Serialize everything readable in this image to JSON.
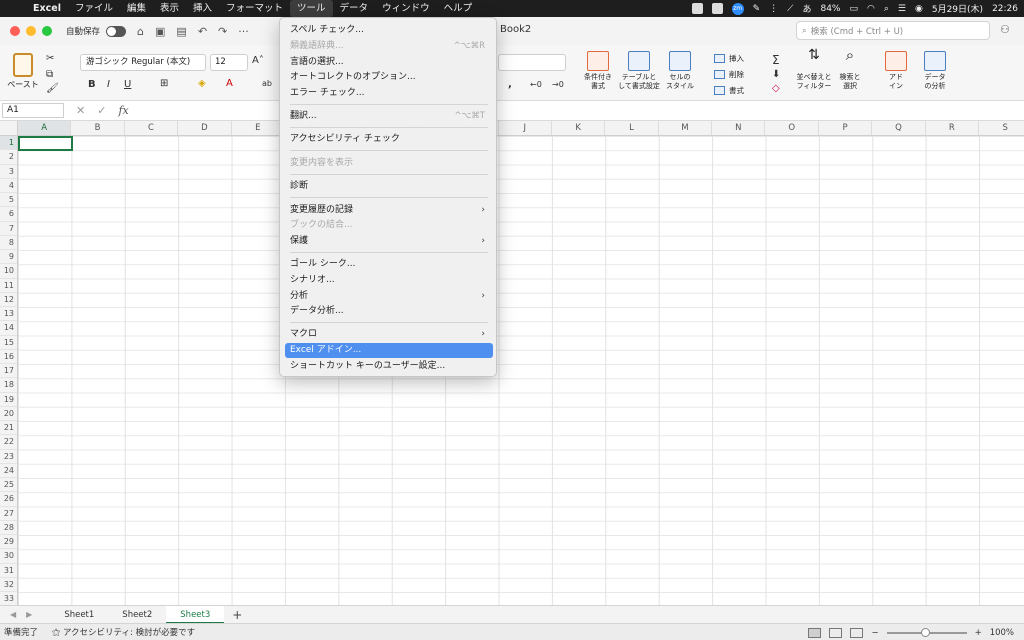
{
  "menubar": {
    "app": "Excel",
    "items": [
      "ファイル",
      "編集",
      "表示",
      "挿入",
      "フォーマット",
      "ツール",
      "データ",
      "ウィンドウ",
      "ヘルプ"
    ],
    "active": "ツール",
    "battery": "84%",
    "date": "5月29日(木)",
    "time": "22:26",
    "ime": "あ"
  },
  "titlebar": {
    "autosave": "自動保存",
    "doc_title": "Book2",
    "search_placeholder": "検索 (Cmd + Ctrl + U)"
  },
  "ribbon": {
    "paste": "ペースト",
    "font": "游ゴシック Regular (本文)",
    "size": "12",
    "bold": "B",
    "italic": "I",
    "underline": "U",
    "cond_format": "条件付き\n書式",
    "table_format": "テーブルと\nして書式設定",
    "cell_style": "セルの\nスタイル",
    "insert": "挿入",
    "delete": "削除",
    "format": "書式",
    "sort_filter": "並べ替えと\nフィルター",
    "find_select": "検索と\n選択",
    "addins": "アド\nイン",
    "data_analysis": "データ\nの分析"
  },
  "formulabar": {
    "namebox": "A1",
    "fx": "fx"
  },
  "grid": {
    "columns": [
      "A",
      "B",
      "C",
      "D",
      "E",
      "F",
      "G",
      "H",
      "I",
      "J",
      "K",
      "L",
      "M",
      "N",
      "O",
      "P",
      "Q",
      "R",
      "S"
    ],
    "rows": [
      "1",
      "2",
      "3",
      "4",
      "5",
      "6",
      "7",
      "8",
      "9",
      "10",
      "11",
      "12",
      "13",
      "14",
      "15",
      "16",
      "17",
      "18",
      "19",
      "20",
      "21",
      "22",
      "23",
      "24",
      "25",
      "26",
      "27",
      "28",
      "29",
      "30",
      "31",
      "32",
      "33"
    ]
  },
  "sheets": [
    "Sheet1",
    "Sheet2",
    "Sheet3"
  ],
  "active_sheet": "Sheet3",
  "statusbar": {
    "ready": "準備完了",
    "accessibility": "アクセシビリティ: 検討が必要です",
    "zoom": "100%"
  },
  "tools_menu": {
    "spell": "スペル チェック...",
    "thesaurus": "類義語辞典...",
    "thesaurus_shortcut": "^⌥⌘R",
    "language": "言語の選択...",
    "autocorrect": "オートコレクトのオプション...",
    "error_check": "エラー チェック...",
    "translate": "翻訳...",
    "translate_shortcut": "^⌥⌘T",
    "accessibility_check": "アクセシビリティ チェック",
    "show_changes": "変更内容を表示",
    "diagnostics": "診断",
    "track_changes": "変更履歴の記録",
    "merge_workbooks": "ブックの結合...",
    "protect": "保護",
    "goal_seek": "ゴール シーク...",
    "scenario": "シナリオ...",
    "analysis": "分析",
    "data_analysis": "データ分析...",
    "macro": "マクロ",
    "excel_addins": "Excel アドイン...",
    "shortcut_keys": "ショートカット キーのユーザー設定..."
  }
}
